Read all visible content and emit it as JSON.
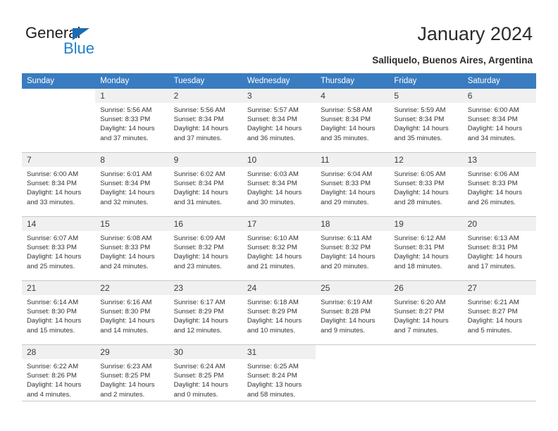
{
  "brand": {
    "name_part1": "General",
    "name_part2": "Blue",
    "accent_color": "#2380c8",
    "triangle_color": "#1b6cb5"
  },
  "header": {
    "title": "January 2024",
    "location": "Salliquelo, Buenos Aires, Argentina"
  },
  "calendar": {
    "header_bg": "#3a7cc0",
    "daynum_bg": "#f0f0f0",
    "weekdays": [
      "Sunday",
      "Monday",
      "Tuesday",
      "Wednesday",
      "Thursday",
      "Friday",
      "Saturday"
    ],
    "weeks": [
      [
        {
          "day": "",
          "sunrise": "",
          "sunset": "",
          "daylight1": "",
          "daylight2": "",
          "blank": true
        },
        {
          "day": "1",
          "sunrise": "Sunrise: 5:56 AM",
          "sunset": "Sunset: 8:33 PM",
          "daylight1": "Daylight: 14 hours",
          "daylight2": "and 37 minutes."
        },
        {
          "day": "2",
          "sunrise": "Sunrise: 5:56 AM",
          "sunset": "Sunset: 8:34 PM",
          "daylight1": "Daylight: 14 hours",
          "daylight2": "and 37 minutes."
        },
        {
          "day": "3",
          "sunrise": "Sunrise: 5:57 AM",
          "sunset": "Sunset: 8:34 PM",
          "daylight1": "Daylight: 14 hours",
          "daylight2": "and 36 minutes."
        },
        {
          "day": "4",
          "sunrise": "Sunrise: 5:58 AM",
          "sunset": "Sunset: 8:34 PM",
          "daylight1": "Daylight: 14 hours",
          "daylight2": "and 35 minutes."
        },
        {
          "day": "5",
          "sunrise": "Sunrise: 5:59 AM",
          "sunset": "Sunset: 8:34 PM",
          "daylight1": "Daylight: 14 hours",
          "daylight2": "and 35 minutes."
        },
        {
          "day": "6",
          "sunrise": "Sunrise: 6:00 AM",
          "sunset": "Sunset: 8:34 PM",
          "daylight1": "Daylight: 14 hours",
          "daylight2": "and 34 minutes."
        }
      ],
      [
        {
          "day": "7",
          "sunrise": "Sunrise: 6:00 AM",
          "sunset": "Sunset: 8:34 PM",
          "daylight1": "Daylight: 14 hours",
          "daylight2": "and 33 minutes."
        },
        {
          "day": "8",
          "sunrise": "Sunrise: 6:01 AM",
          "sunset": "Sunset: 8:34 PM",
          "daylight1": "Daylight: 14 hours",
          "daylight2": "and 32 minutes."
        },
        {
          "day": "9",
          "sunrise": "Sunrise: 6:02 AM",
          "sunset": "Sunset: 8:34 PM",
          "daylight1": "Daylight: 14 hours",
          "daylight2": "and 31 minutes."
        },
        {
          "day": "10",
          "sunrise": "Sunrise: 6:03 AM",
          "sunset": "Sunset: 8:34 PM",
          "daylight1": "Daylight: 14 hours",
          "daylight2": "and 30 minutes."
        },
        {
          "day": "11",
          "sunrise": "Sunrise: 6:04 AM",
          "sunset": "Sunset: 8:33 PM",
          "daylight1": "Daylight: 14 hours",
          "daylight2": "and 29 minutes."
        },
        {
          "day": "12",
          "sunrise": "Sunrise: 6:05 AM",
          "sunset": "Sunset: 8:33 PM",
          "daylight1": "Daylight: 14 hours",
          "daylight2": "and 28 minutes."
        },
        {
          "day": "13",
          "sunrise": "Sunrise: 6:06 AM",
          "sunset": "Sunset: 8:33 PM",
          "daylight1": "Daylight: 14 hours",
          "daylight2": "and 26 minutes."
        }
      ],
      [
        {
          "day": "14",
          "sunrise": "Sunrise: 6:07 AM",
          "sunset": "Sunset: 8:33 PM",
          "daylight1": "Daylight: 14 hours",
          "daylight2": "and 25 minutes."
        },
        {
          "day": "15",
          "sunrise": "Sunrise: 6:08 AM",
          "sunset": "Sunset: 8:33 PM",
          "daylight1": "Daylight: 14 hours",
          "daylight2": "and 24 minutes."
        },
        {
          "day": "16",
          "sunrise": "Sunrise: 6:09 AM",
          "sunset": "Sunset: 8:32 PM",
          "daylight1": "Daylight: 14 hours",
          "daylight2": "and 23 minutes."
        },
        {
          "day": "17",
          "sunrise": "Sunrise: 6:10 AM",
          "sunset": "Sunset: 8:32 PM",
          "daylight1": "Daylight: 14 hours",
          "daylight2": "and 21 minutes."
        },
        {
          "day": "18",
          "sunrise": "Sunrise: 6:11 AM",
          "sunset": "Sunset: 8:32 PM",
          "daylight1": "Daylight: 14 hours",
          "daylight2": "and 20 minutes."
        },
        {
          "day": "19",
          "sunrise": "Sunrise: 6:12 AM",
          "sunset": "Sunset: 8:31 PM",
          "daylight1": "Daylight: 14 hours",
          "daylight2": "and 18 minutes."
        },
        {
          "day": "20",
          "sunrise": "Sunrise: 6:13 AM",
          "sunset": "Sunset: 8:31 PM",
          "daylight1": "Daylight: 14 hours",
          "daylight2": "and 17 minutes."
        }
      ],
      [
        {
          "day": "21",
          "sunrise": "Sunrise: 6:14 AM",
          "sunset": "Sunset: 8:30 PM",
          "daylight1": "Daylight: 14 hours",
          "daylight2": "and 15 minutes."
        },
        {
          "day": "22",
          "sunrise": "Sunrise: 6:16 AM",
          "sunset": "Sunset: 8:30 PM",
          "daylight1": "Daylight: 14 hours",
          "daylight2": "and 14 minutes."
        },
        {
          "day": "23",
          "sunrise": "Sunrise: 6:17 AM",
          "sunset": "Sunset: 8:29 PM",
          "daylight1": "Daylight: 14 hours",
          "daylight2": "and 12 minutes."
        },
        {
          "day": "24",
          "sunrise": "Sunrise: 6:18 AM",
          "sunset": "Sunset: 8:29 PM",
          "daylight1": "Daylight: 14 hours",
          "daylight2": "and 10 minutes."
        },
        {
          "day": "25",
          "sunrise": "Sunrise: 6:19 AM",
          "sunset": "Sunset: 8:28 PM",
          "daylight1": "Daylight: 14 hours",
          "daylight2": "and 9 minutes."
        },
        {
          "day": "26",
          "sunrise": "Sunrise: 6:20 AM",
          "sunset": "Sunset: 8:27 PM",
          "daylight1": "Daylight: 14 hours",
          "daylight2": "and 7 minutes."
        },
        {
          "day": "27",
          "sunrise": "Sunrise: 6:21 AM",
          "sunset": "Sunset: 8:27 PM",
          "daylight1": "Daylight: 14 hours",
          "daylight2": "and 5 minutes."
        }
      ],
      [
        {
          "day": "28",
          "sunrise": "Sunrise: 6:22 AM",
          "sunset": "Sunset: 8:26 PM",
          "daylight1": "Daylight: 14 hours",
          "daylight2": "and 4 minutes."
        },
        {
          "day": "29",
          "sunrise": "Sunrise: 6:23 AM",
          "sunset": "Sunset: 8:25 PM",
          "daylight1": "Daylight: 14 hours",
          "daylight2": "and 2 minutes."
        },
        {
          "day": "30",
          "sunrise": "Sunrise: 6:24 AM",
          "sunset": "Sunset: 8:25 PM",
          "daylight1": "Daylight: 14 hours",
          "daylight2": "and 0 minutes."
        },
        {
          "day": "31",
          "sunrise": "Sunrise: 6:25 AM",
          "sunset": "Sunset: 8:24 PM",
          "daylight1": "Daylight: 13 hours",
          "daylight2": "and 58 minutes."
        },
        {
          "day": "",
          "sunrise": "",
          "sunset": "",
          "daylight1": "",
          "daylight2": "",
          "blank": true
        },
        {
          "day": "",
          "sunrise": "",
          "sunset": "",
          "daylight1": "",
          "daylight2": "",
          "blank": true
        },
        {
          "day": "",
          "sunrise": "",
          "sunset": "",
          "daylight1": "",
          "daylight2": "",
          "blank": true
        }
      ]
    ]
  }
}
